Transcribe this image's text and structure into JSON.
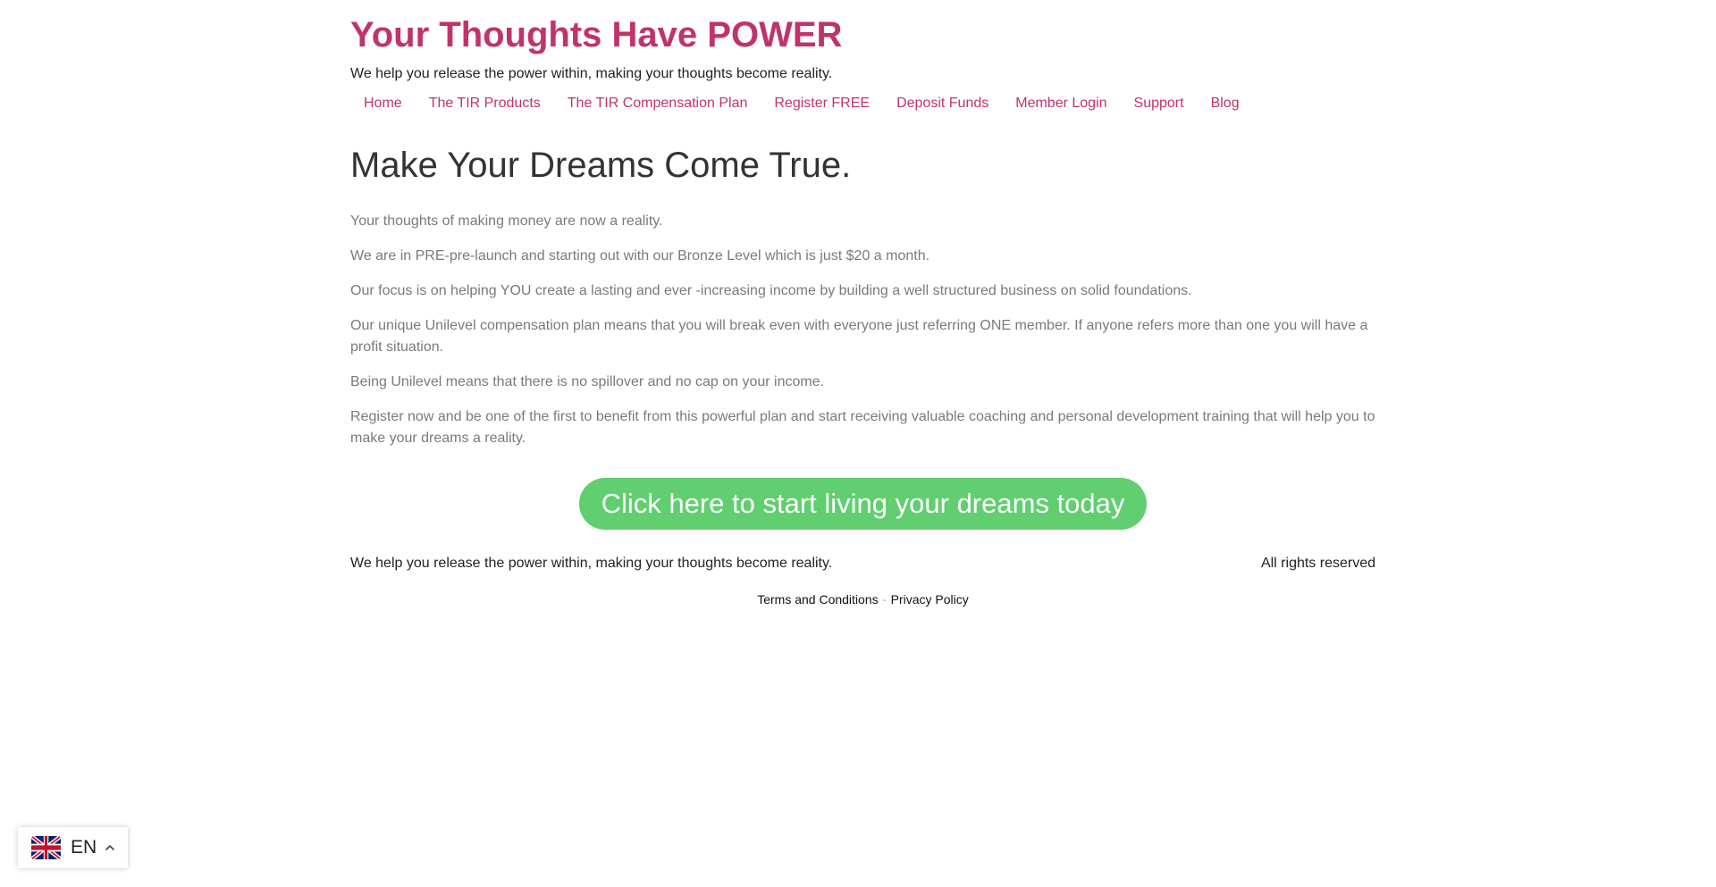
{
  "header": {
    "site_title": "Your Thoughts Have POWER",
    "tagline": "We help you release the power within, making your thoughts become reality."
  },
  "nav": {
    "items": [
      {
        "label": "Home"
      },
      {
        "label": "The TIR Products"
      },
      {
        "label": "The TIR Compensation Plan"
      },
      {
        "label": "Register FREE"
      },
      {
        "label": "Deposit Funds"
      },
      {
        "label": "Member Login"
      },
      {
        "label": "Support"
      },
      {
        "label": "Blog"
      }
    ]
  },
  "main": {
    "headline": "Make Your Dreams Come True.",
    "paragraphs": [
      "Your thoughts of making money are now a reality.",
      "We are in PRE-pre-launch and starting out with our Bronze Level which is just $20 a month.",
      "Our focus is on helping YOU create a lasting and ever -increasing income by building a well structured business on solid foundations.",
      "Our unique Unilevel compensation plan means that you will break even with everyone just referring ONE member. If anyone refers more than one you will have a profit situation.",
      "Being Unilevel means that there is no spillover and no cap on your income.",
      "Register now and be one of the first to benefit from this powerful plan and start receiving valuable coaching and personal development training that will help you to make your dreams a reality."
    ],
    "cta_label": "Click here to start living your dreams today"
  },
  "footer": {
    "tagline": "We help you release the power within, making your thoughts become reality.",
    "rights": "All rights reserved",
    "links": {
      "terms": "Terms and Conditions",
      "separator": "-",
      "privacy": "Privacy Policy"
    }
  },
  "language_switcher": {
    "code": "EN",
    "flag_icon": "uk-flag-icon",
    "caret_icon": "chevron-up-icon"
  },
  "colors": {
    "brand_pink": "#c0336c",
    "cta_green": "#61ce70",
    "body_gray": "#7a7a7a",
    "headline_dark": "#333333"
  }
}
